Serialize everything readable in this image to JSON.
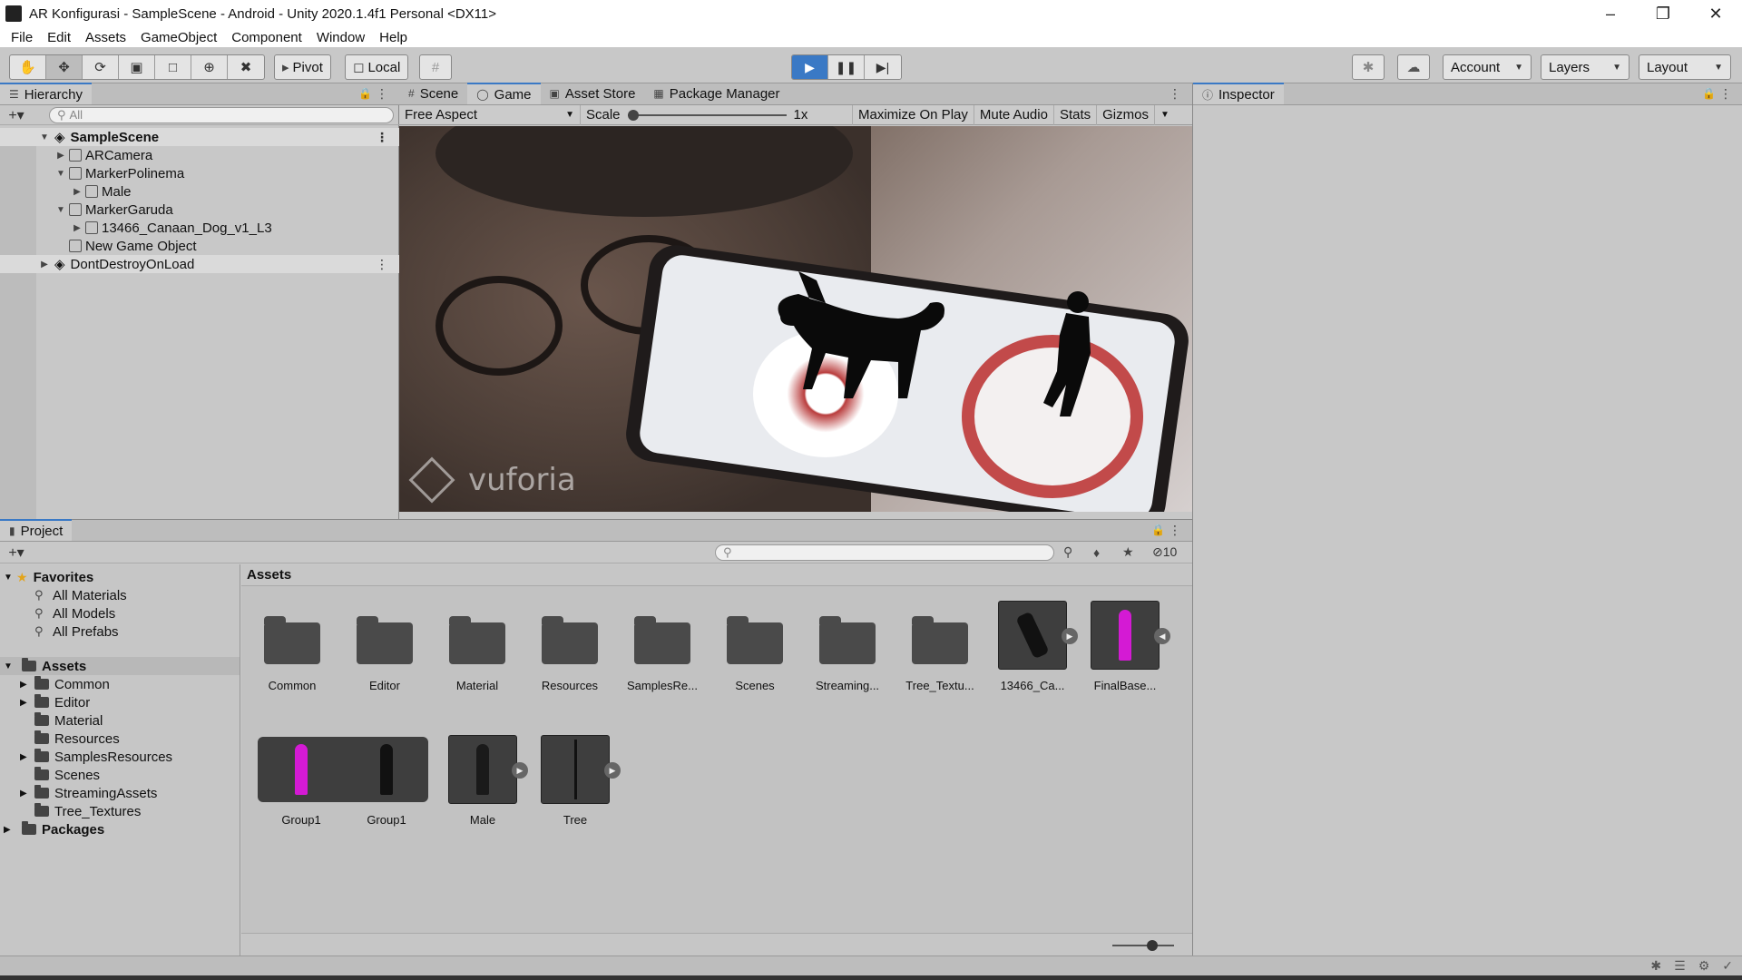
{
  "window": {
    "title": "AR Konfigurasi - SampleScene - Android - Unity 2020.1.4f1 Personal <DX11>"
  },
  "menu": [
    "File",
    "Edit",
    "Assets",
    "GameObject",
    "Component",
    "Window",
    "Help"
  ],
  "toolbar": {
    "pivot_label": "Pivot",
    "local_label": "Local",
    "account_label": "Account",
    "layers_label": "Layers",
    "layout_label": "Layout"
  },
  "hierarchy": {
    "tab_label": "Hierarchy",
    "search_placeholder": "All",
    "items": [
      {
        "label": "SampleScene"
      },
      {
        "label": "ARCamera"
      },
      {
        "label": "MarkerPolinema"
      },
      {
        "label": "Male"
      },
      {
        "label": "MarkerGaruda"
      },
      {
        "label": "13466_Canaan_Dog_v1_L3"
      },
      {
        "label": "New Game Object"
      },
      {
        "label": "DontDestroyOnLoad"
      }
    ]
  },
  "game": {
    "tabs": [
      "Scene",
      "Game",
      "Asset Store",
      "Package Manager"
    ],
    "aspect": "Free Aspect",
    "scale_label": "Scale",
    "scale_value": "1x",
    "maximize_label": "Maximize On Play",
    "mute_label": "Mute Audio",
    "stats_label": "Stats",
    "gizmos_label": "Gizmos",
    "watermark": "vuforia"
  },
  "inspector": {
    "tab_label": "Inspector"
  },
  "project": {
    "tab_label": "Project",
    "hidden_count": "10",
    "breadcrumb": "Assets",
    "favorites_label": "Favorites",
    "favorites": [
      "All Materials",
      "All Models",
      "All Prefabs"
    ],
    "assets_root_label": "Assets",
    "folders": [
      "Common",
      "Editor",
      "Material",
      "Resources",
      "SamplesResources",
      "Scenes",
      "StreamingAssets",
      "Tree_Textures"
    ],
    "packages_label": "Packages",
    "grid_row1": [
      "Common",
      "Editor",
      "Material",
      "Resources",
      "SamplesRe...",
      "Scenes",
      "Streaming...",
      "Tree_Textu...",
      "13466_Ca...",
      "FinalBase..."
    ],
    "grid_row2": [
      "Group1",
      "Group1",
      "Male",
      "Tree"
    ]
  },
  "colors": {
    "accent": "#3a79c5",
    "panel": "#c8c8c8",
    "pink_model": "#d41ad4"
  }
}
